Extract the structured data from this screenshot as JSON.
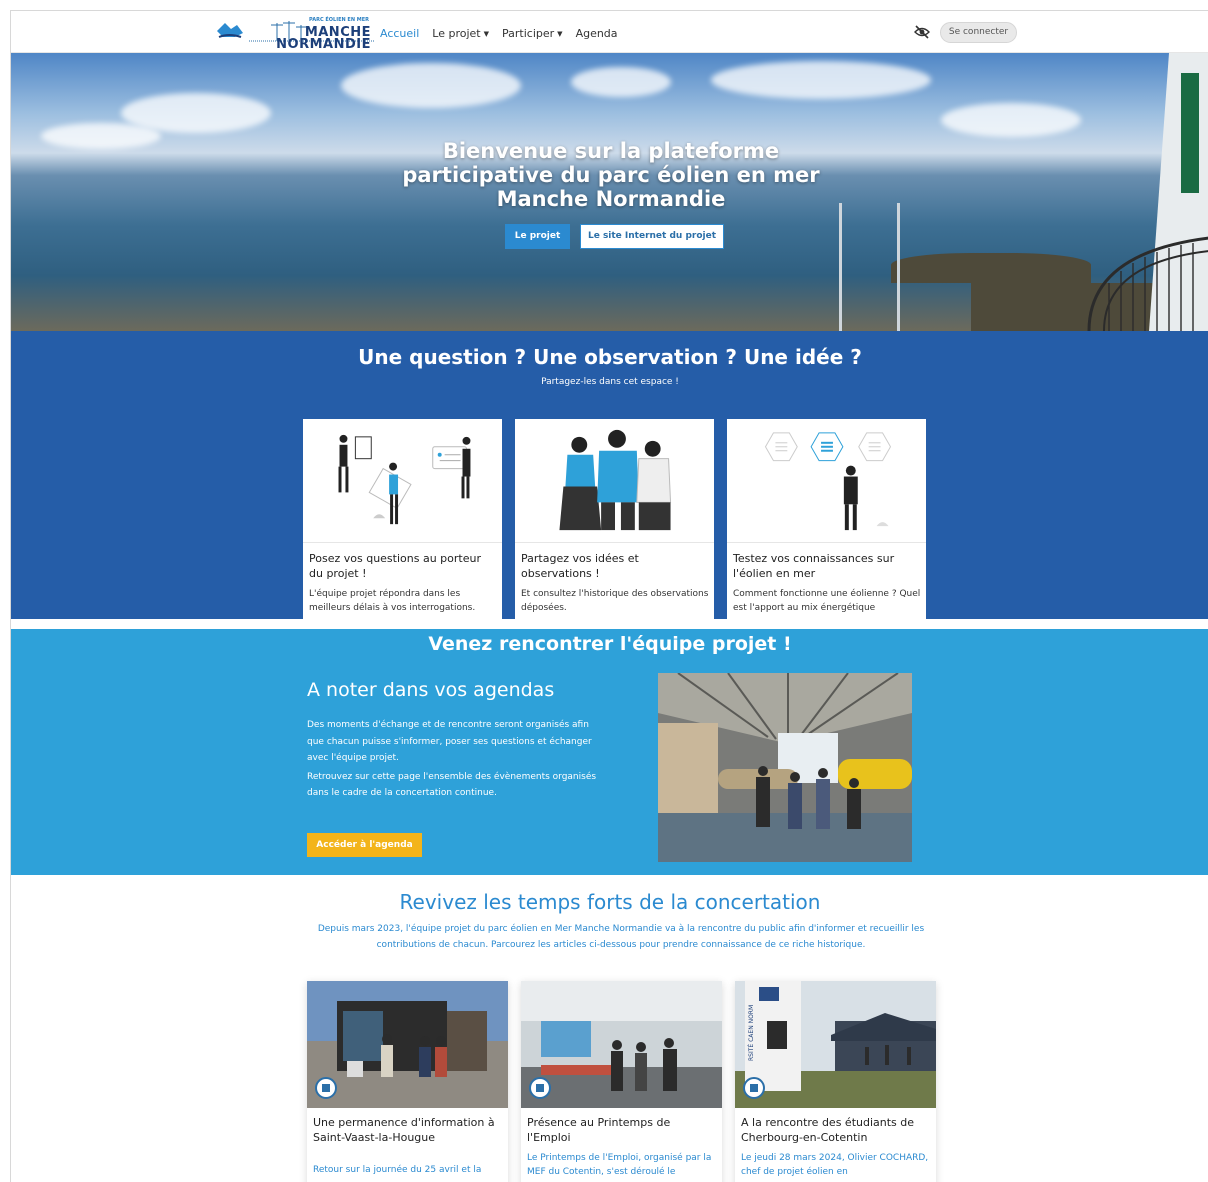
{
  "header": {
    "logo_small": "PARC ÉOLIEN EN MER",
    "logo_line1": "MANCHE",
    "logo_line2": "NORMANDIE",
    "nav": [
      {
        "label": "Accueil",
        "active": true
      },
      {
        "label": "Le projet",
        "dropdown": true
      },
      {
        "label": "Participer",
        "dropdown": true
      },
      {
        "label": "Agenda"
      }
    ],
    "accessibility_icon": "eye-slash-icon",
    "login_label": "Se connecter"
  },
  "hero": {
    "title": "Bienvenue sur la plateforme participative du parc éolien en mer Manche Normandie",
    "btn_project": "Le projet",
    "btn_site": "Le site Internet du projet"
  },
  "question_section": {
    "title": "Une question ? Une observation ? Une idée ?",
    "subtitle": "Partagez-les dans cet espace !",
    "cards": [
      {
        "title": "Posez vos questions au porteur du projet !",
        "text": "L'équipe projet répondra dans les meilleurs délais à vos interrogations."
      },
      {
        "title": "Partagez vos idées et observations !",
        "text": "Et consultez l'historique des observations déposées."
      },
      {
        "title": "Testez vos connaissances sur l'éolien en mer",
        "text": "Comment fonctionne une éolienne ? Quel est l'apport au mix énergétique"
      }
    ]
  },
  "agenda_section": {
    "title": "Venez rencontrer l'équipe projet !",
    "subtitle": "A noter dans vos agendas",
    "paragraph1": "Des moments d'échange et de rencontre seront organisés afin que chacun puisse s'informer, poser ses questions et échanger avec l'équipe projet.",
    "paragraph2": "Retrouvez sur cette page l'ensemble des évènements organisés dans le cadre de la concertation continue.",
    "button": "Accéder à l'agenda"
  },
  "revivez_section": {
    "title": "Revivez les temps forts de la concertation",
    "intro": "Depuis mars 2023, l'équipe projet du parc éolien en Mer Manche Normandie va à la rencontre du public afin d'informer et recueillir les contributions de chacun. Parcourez les articles ci-dessous pour prendre connaissance de ce riche historique.",
    "articles": [
      {
        "title": "Une permanence d'information à Saint-Vaast-la-Hougue",
        "excerpt": "Retour sur la journée du 25 avril et la",
        "icon": "newspaper-icon"
      },
      {
        "title": "Présence au Printemps de l'Emploi",
        "excerpt": "Le Printemps de l'Emploi, organisé par la MEF du Cotentin, s'est déroulé le",
        "icon": "newspaper-icon"
      },
      {
        "title": "A la rencontre des étudiants de Cherbourg-en-Cotentin",
        "excerpt": "Le jeudi 28 mars 2024, Olivier COCHARD, chef de projet éolien en",
        "icon": "newspaper-icon"
      }
    ],
    "photo_sign_text": "RSITÉ CAEN NORM"
  }
}
